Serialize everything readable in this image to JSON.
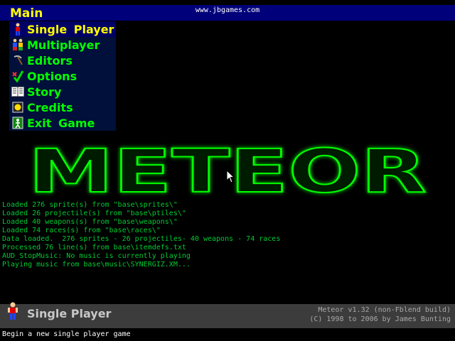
{
  "header": {
    "menu_title": "Main",
    "url": "www.jbgames.com"
  },
  "menu": {
    "selected_index": 0,
    "items": [
      {
        "label": "Single Player",
        "icon": "player-icon"
      },
      {
        "label": "Multiplayer",
        "icon": "players-icon"
      },
      {
        "label": "Editors",
        "icon": "pickaxe-icon"
      },
      {
        "label": "Options",
        "icon": "checkmark-icon"
      },
      {
        "label": "Story",
        "icon": "book-icon"
      },
      {
        "label": "Credits",
        "icon": "credits-icon"
      },
      {
        "label": "Exit Game",
        "icon": "exit-icon"
      }
    ]
  },
  "logo": {
    "text": "METEOR",
    "color": "#00ff00"
  },
  "console": {
    "lines": [
      "Loaded 276 sprite(s) from \"base\\sprites\\\"",
      "Loaded 26 projectile(s) from \"base\\ptiles\\\"",
      "Loaded 40 weapons(s) from \"base\\weapons\\\"",
      "Loaded 74 races(s) from \"base\\races\\\"",
      "Data loaded.  276 sprites - 26 projectiles- 40 weapons - 74 races",
      "Processed 76 line(s) from base\\itemdefs.txt",
      "AUD_StopMusic: No music is currently playing",
      "Playing music from base\\music\\SYNERGIZ.XM..."
    ]
  },
  "footer": {
    "selected_title": "Single Player",
    "selected_icon": "player-icon",
    "version": "Meteor v1.32 (non-Fblend build)",
    "copyright": "(C) 1998 to 2006 by James Bunting",
    "status": "Begin a new single player game"
  },
  "colors": {
    "menu_text": "#00ff00",
    "menu_selected": "#ffff00",
    "header_bg": "#00007a",
    "console_text": "#00cc33"
  }
}
